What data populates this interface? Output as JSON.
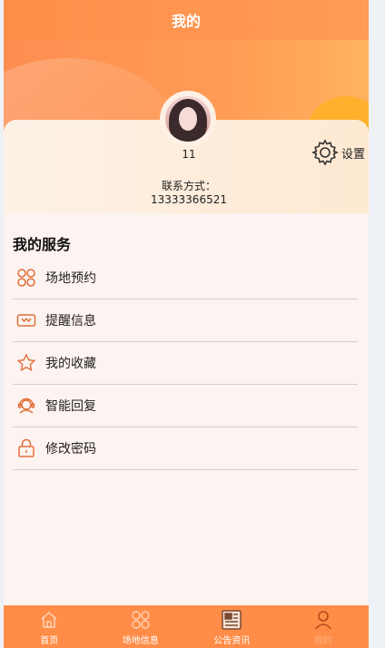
{
  "nav": {
    "title": "我的"
  },
  "profile": {
    "username": "11",
    "settings_label": "设置",
    "contact_label": "联系方式：",
    "contact_value": "13333366521"
  },
  "services": {
    "title": "我的服务",
    "items": [
      {
        "label": "场地预约",
        "icon": "venue-grid-icon"
      },
      {
        "label": "提醒信息",
        "icon": "reminder-icon"
      },
      {
        "label": "我的收藏",
        "icon": "star-icon"
      },
      {
        "label": "智能回复",
        "icon": "support-agent-icon"
      },
      {
        "label": "修改密码",
        "icon": "lock-icon"
      }
    ]
  },
  "tabbar": {
    "tabs": [
      {
        "label": "首页",
        "icon": "home-icon"
      },
      {
        "label": "场地信息",
        "icon": "grid-icon"
      },
      {
        "label": "公告资讯",
        "icon": "news-icon"
      },
      {
        "label": "我的",
        "icon": "user-icon",
        "active": true
      }
    ]
  },
  "colors": {
    "accent": "#ff8d48",
    "icon": "#e0703a"
  }
}
